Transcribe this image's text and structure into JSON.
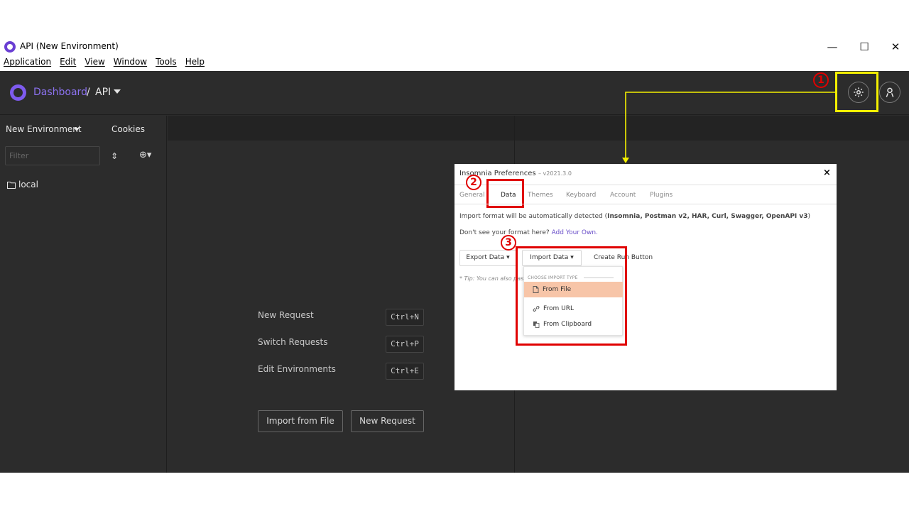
{
  "window": {
    "title": "API (New Environment)",
    "controls": {
      "minimize": "—",
      "maximize": "☐",
      "close": "✕"
    }
  },
  "menubar": [
    "Application",
    "Edit",
    "View",
    "Window",
    "Tools",
    "Help"
  ],
  "header": {
    "crumb_dashboard": "Dashboard",
    "crumb_sep": "/",
    "crumb_api": "API"
  },
  "sidebar": {
    "environment": "New Environment",
    "cookies": "Cookies",
    "filter_placeholder": "Filter",
    "folder": "local"
  },
  "shortcuts": [
    {
      "label": "New Request",
      "key": "Ctrl+N"
    },
    {
      "label": "Switch Requests",
      "key": "Ctrl+P"
    },
    {
      "label": "Edit Environments",
      "key": "Ctrl+E"
    }
  ],
  "buttons": {
    "import_file": "Import from File",
    "new_request": "New Request"
  },
  "annotations": {
    "step1": "1",
    "step2": "2",
    "step3": "3"
  },
  "preferences": {
    "title": "Insomnia Preferences",
    "version": "– v2021.3.0",
    "close": "×",
    "tabs": [
      "General",
      "Data",
      "Themes",
      "Keyboard",
      "Account",
      "Plugins"
    ],
    "desc_prefix": "Import format will be automatically detected (",
    "desc_formats": "Insomnia, Postman v2, HAR, Curl, Swagger, OpenAPI v3",
    "desc_suffix": ")",
    "format_question": "Don't see your format here?",
    "format_link": "Add Your Own.",
    "export_label": "Export Data",
    "import_label": "Import Data",
    "create_run": "Create Run Button",
    "tip": "* Tip: You can also paste"
  },
  "import_menu": {
    "header": "CHOOSE IMPORT TYPE",
    "items": [
      "From File",
      "From URL",
      "From Clipboard"
    ]
  },
  "colors": {
    "accent": "#7e5bef",
    "highlight_yellow": "#f4f000",
    "annotation_red": "#e00000",
    "active_item": "#f7c5a8"
  }
}
